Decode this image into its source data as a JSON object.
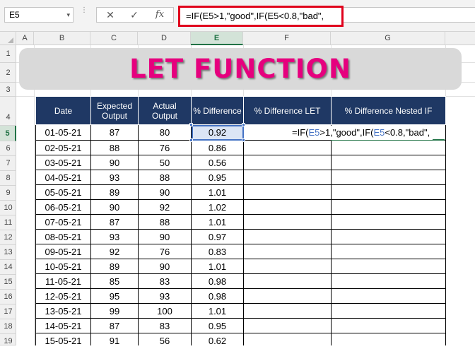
{
  "formula_bar": {
    "name_box": "E5",
    "name_box_arrow": "▾",
    "cancel_icon": "✕",
    "enter_icon": "✓",
    "fx_label": "fx",
    "formula": "=IF(E5>1,\"good\",IF(E5<0.8,\"bad\","
  },
  "columns": [
    "A",
    "B",
    "C",
    "D",
    "E",
    "F",
    "G"
  ],
  "rows": [
    "1",
    "2",
    "3",
    "4",
    "5",
    "6",
    "7",
    "8",
    "9",
    "10",
    "11",
    "12",
    "13",
    "14",
    "15",
    "16",
    "17",
    "18",
    "19"
  ],
  "active_cell": "E5",
  "banner": {
    "title": "LET FUNCTION"
  },
  "table": {
    "headers": [
      "Date",
      "Expected Output",
      "Actual Output",
      "% Difference",
      "% Difference LET",
      "% Difference Nested IF"
    ],
    "rows": [
      [
        "01-05-21",
        "87",
        "80",
        "0.92"
      ],
      [
        "02-05-21",
        "88",
        "76",
        "0.86"
      ],
      [
        "03-05-21",
        "90",
        "50",
        "0.56"
      ],
      [
        "04-05-21",
        "93",
        "88",
        "0.95"
      ],
      [
        "05-05-21",
        "89",
        "90",
        "1.01"
      ],
      [
        "06-05-21",
        "90",
        "92",
        "1.02"
      ],
      [
        "07-05-21",
        "87",
        "88",
        "1.01"
      ],
      [
        "08-05-21",
        "93",
        "90",
        "0.97"
      ],
      [
        "09-05-21",
        "92",
        "76",
        "0.83"
      ],
      [
        "10-05-21",
        "89",
        "90",
        "1.01"
      ],
      [
        "11-05-21",
        "85",
        "83",
        "0.98"
      ],
      [
        "12-05-21",
        "95",
        "93",
        "0.98"
      ],
      [
        "13-05-21",
        "99",
        "100",
        "1.01"
      ],
      [
        "14-05-21",
        "87",
        "83",
        "0.95"
      ],
      [
        "15-05-21",
        "91",
        "56",
        "0.62"
      ]
    ]
  },
  "editing": {
    "p1": "=IF(",
    "ref1": "E5",
    "p2": ">1,\"good\",IF(",
    "ref2": "E5",
    "p3": "<0.8,\"bad\","
  },
  "colors": {
    "header_fill": "#1f3864",
    "title_color": "#e6007e",
    "banner_fill": "#d9d9d9",
    "highlight_border": "#e0001b",
    "selection": "#4472c4",
    "excel_green": "#217346"
  }
}
